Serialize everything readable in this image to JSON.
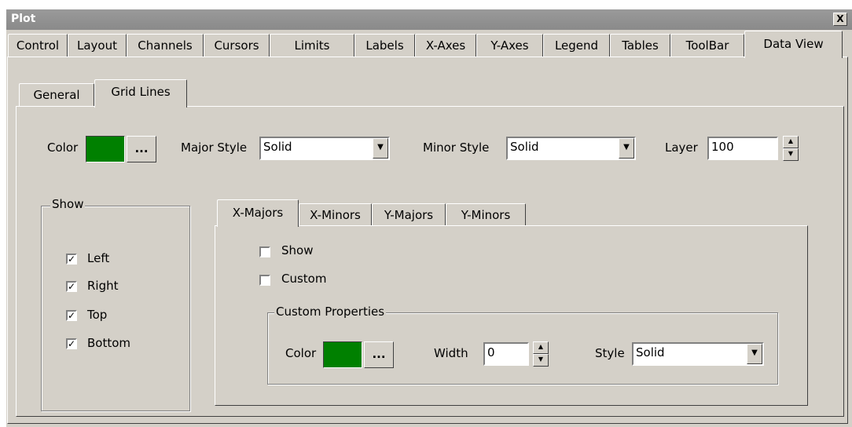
{
  "window": {
    "title": "Plot",
    "close_label": "X"
  },
  "main_tabs": [
    "Control",
    "Layout",
    "Channels",
    "Cursors",
    "Limits",
    "Labels",
    "X-Axes",
    "Y-Axes",
    "Legend",
    "Tables",
    "ToolBar",
    "Data View"
  ],
  "sub_tabs": [
    "General",
    "Grid Lines"
  ],
  "grid": {
    "color_label": "Color",
    "color_value": "#008000",
    "ellipsis": "...",
    "major_style_label": "Major Style",
    "major_style_value": "Solid",
    "minor_style_label": "Minor Style",
    "minor_style_value": "Solid",
    "layer_label": "Layer",
    "layer_value": "100"
  },
  "show": {
    "title": "Show",
    "items": [
      {
        "label": "Left",
        "checked": true
      },
      {
        "label": "Right",
        "checked": true
      },
      {
        "label": "Top",
        "checked": true
      },
      {
        "label": "Bottom",
        "checked": true
      }
    ]
  },
  "axis_tabs": [
    "X-Majors",
    "X-Minors",
    "Y-Majors",
    "Y-Minors"
  ],
  "xmajors": {
    "show_label": "Show",
    "show_checked": false,
    "custom_label": "Custom",
    "custom_checked": false,
    "custom_props": {
      "title": "Custom Properties",
      "color_label": "Color",
      "color_value": "#008000",
      "ellipsis": "...",
      "width_label": "Width",
      "width_value": "0",
      "style_label": "Style",
      "style_value": "Solid"
    }
  }
}
